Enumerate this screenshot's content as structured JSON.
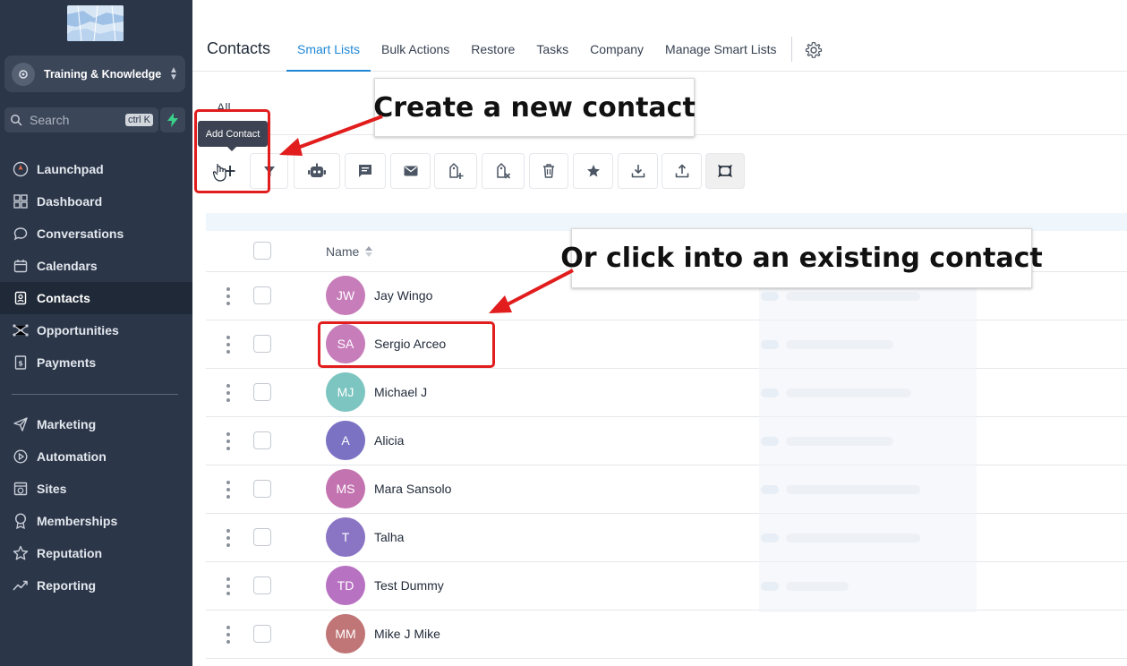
{
  "sidebar": {
    "account_name": "Training & Knowledge",
    "search_placeholder": "Search",
    "search_shortcut": "ctrl K",
    "nav_primary": [
      {
        "label": "Launchpad",
        "icon": "rocket-icon"
      },
      {
        "label": "Dashboard",
        "icon": "grid-icon"
      },
      {
        "label": "Conversations",
        "icon": "chat-bubble-icon"
      },
      {
        "label": "Calendars",
        "icon": "calendar-icon"
      },
      {
        "label": "Contacts",
        "icon": "contact-book-icon",
        "active": true
      },
      {
        "label": "Opportunities",
        "icon": "network-icon"
      },
      {
        "label": "Payments",
        "icon": "invoice-icon"
      }
    ],
    "nav_secondary": [
      {
        "label": "Marketing",
        "icon": "send-icon"
      },
      {
        "label": "Automation",
        "icon": "play-circle-icon"
      },
      {
        "label": "Sites",
        "icon": "globe-window-icon"
      },
      {
        "label": "Memberships",
        "icon": "badge-icon"
      },
      {
        "label": "Reputation",
        "icon": "star-icon"
      },
      {
        "label": "Reporting",
        "icon": "trend-icon"
      }
    ]
  },
  "header": {
    "title": "Contacts",
    "tabs": [
      {
        "label": "Smart Lists",
        "active": true
      },
      {
        "label": "Bulk Actions"
      },
      {
        "label": "Restore"
      },
      {
        "label": "Tasks"
      },
      {
        "label": "Company"
      },
      {
        "label": "Manage Smart Lists"
      }
    ]
  },
  "filter": {
    "label": "All"
  },
  "tooltip": {
    "text": "Add Contact"
  },
  "toolbar": [
    {
      "name": "add-contact-button",
      "icon": "plus-icon"
    },
    {
      "name": "filter-button",
      "icon": "filter-icon"
    },
    {
      "name": "automation-button",
      "icon": "robot-icon"
    },
    {
      "name": "sms-button",
      "icon": "message-icon"
    },
    {
      "name": "email-button",
      "icon": "envelope-icon"
    },
    {
      "name": "add-tag-button",
      "icon": "tag-add-icon"
    },
    {
      "name": "remove-tag-button",
      "icon": "tag-remove-icon"
    },
    {
      "name": "delete-button",
      "icon": "trash-icon"
    },
    {
      "name": "review-request-button",
      "icon": "star-icon"
    },
    {
      "name": "import-button",
      "icon": "download-icon"
    },
    {
      "name": "export-button",
      "icon": "upload-icon"
    },
    {
      "name": "merge-button",
      "icon": "merge-icon"
    }
  ],
  "table": {
    "name_header": "Name",
    "rows": [
      {
        "initials": "JW",
        "name": "Jay Wingo",
        "color": "#c77dba"
      },
      {
        "initials": "SA",
        "name": "Sergio Arceo",
        "color": "#c77dba"
      },
      {
        "initials": "MJ",
        "name": "Michael J",
        "color": "#7cc5c0"
      },
      {
        "initials": "A",
        "name": "Alicia",
        "color": "#7b72c4"
      },
      {
        "initials": "MS",
        "name": "Mara Sansolo",
        "color": "#c373b0"
      },
      {
        "initials": "T",
        "name": "Talha",
        "color": "#8a74c4"
      },
      {
        "initials": "TD",
        "name": "Test Dummy",
        "color": "#b872c2"
      },
      {
        "initials": "MM",
        "name": "Mike J Mike",
        "color": "#c07577"
      }
    ]
  },
  "annotations": {
    "new_contact": "Create a new contact",
    "existing_contact": "Or click into an existing contact"
  },
  "colors": {
    "sidebar_bg": "#2b3648",
    "accent": "#1f88d6",
    "annotation_red": "#e11d1d"
  }
}
